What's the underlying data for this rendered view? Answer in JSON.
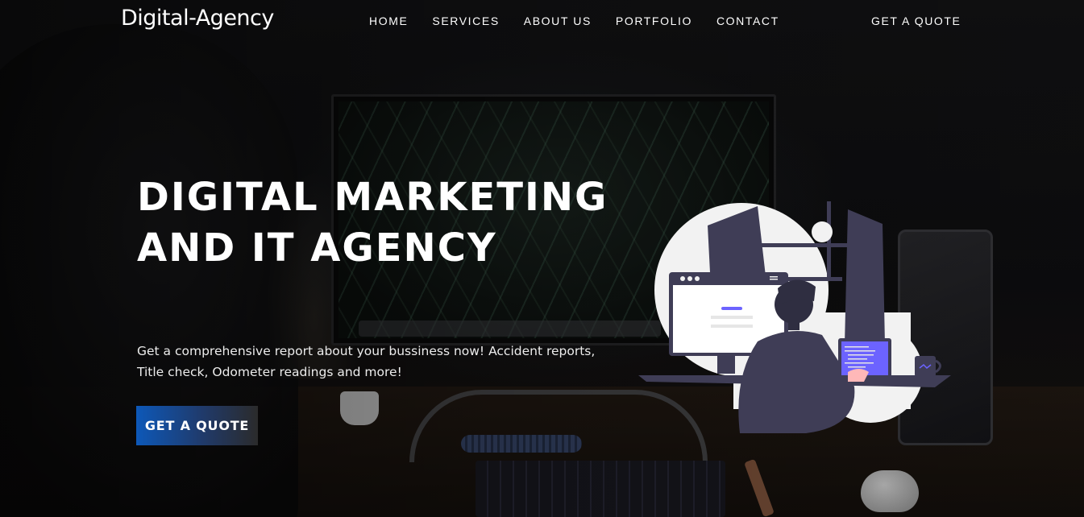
{
  "header": {
    "logo": "Digital-Agency",
    "nav": [
      "HOME",
      "SERVICES",
      "ABOUT US",
      "PORTFOLIO",
      "CONTACT"
    ],
    "cta_label": "GET A QUOTE"
  },
  "hero": {
    "headline": "DIGITAL MARKETING AND IT AGENCY",
    "subtext": "Get a comprehensive report about your bussiness now! Accident reports, Title check, Odometer readings and more!",
    "cta_label": "GET A QUOTE"
  },
  "colors": {
    "cta_gradient_start": "#0d58b8",
    "illustration_dark": "#3f3d56",
    "illustration_accent": "#6c63ff",
    "text": "#ffffff"
  }
}
